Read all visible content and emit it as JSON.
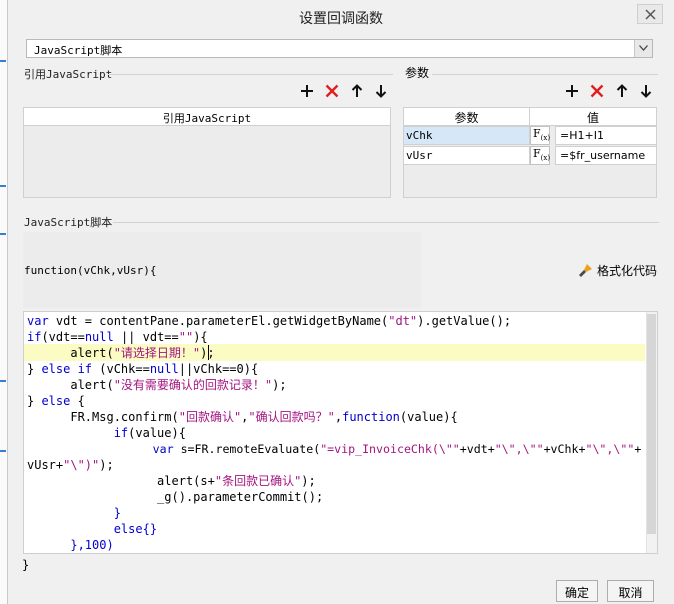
{
  "dialog": {
    "title": "设置回调函数"
  },
  "dropdown": {
    "selected": "JavaScript脚本"
  },
  "ref_section": {
    "label": "引用JavaScript",
    "column_header": "引用JavaScript"
  },
  "param_section": {
    "label": "参数",
    "columns": [
      "参数",
      "值"
    ],
    "rows": [
      {
        "name": "vChk",
        "fx": "F",
        "fx_sub": "(x)",
        "value": "=H1+I1"
      },
      {
        "name": "vUsr",
        "fx": "F",
        "fx_sub": "(x)",
        "value": "=$fr_username"
      }
    ]
  },
  "script_section": {
    "label": "JavaScript脚本",
    "signature": "function(vChk,vUsr){",
    "format_button": "格式化代码",
    "closing_brace": "}"
  },
  "code": {
    "l1": [
      "var",
      " vdt = contentPane.parameterEl.getWidgetByName(",
      "\"dt\"",
      ").getValue();"
    ],
    "l2": [
      "if",
      "(vdt==",
      "null",
      " || vdt==",
      "\"\"",
      "){"
    ],
    "l3": [
      "      alert(",
      "\"请选择日期！\"",
      ");"
    ],
    "l4": [
      "} ",
      "else if",
      " (vChk==",
      "null",
      "||vChk==0){"
    ],
    "l5": [
      "      alert(",
      "\"没有需要确认的回款记录！\"",
      ");"
    ],
    "l6": [
      "} ",
      "else",
      " {"
    ],
    "l7": [
      "      FR.Msg.confirm(",
      "\"回款确认\"",
      ",",
      "\"确认回款吗？\"",
      ",",
      "function",
      "(value){"
    ],
    "l8": [
      "            ",
      "if",
      "(value){"
    ],
    "l9": [
      "                  ",
      "var",
      " s=FR.remoteEvaluate(",
      "\"=vip_InvoiceChk(\\\"\"",
      "+vdt+",
      "\"\\\",\\\"\"",
      "+vChk+",
      "\"\\\",\\\"\"",
      "+"
    ],
    "l10": [
      "vUsr+",
      "\"\\\")\"",
      ");"
    ],
    "l11": [
      "                  alert(s+",
      "\"条回款已确认\"",
      ");"
    ],
    "l12": [
      "                  _g().parameterCommit();"
    ],
    "l13": [
      "            }"
    ],
    "l14": [
      "            ",
      "else",
      "{}"
    ],
    "l15": [
      "      },100)"
    ]
  },
  "buttons": {
    "ok": "确定",
    "cancel": "取消"
  },
  "colors": {
    "keyword": "#0000cc",
    "string": "#a31580",
    "delete": "#e02020",
    "highlight": "#fbfbc4"
  },
  "icons": [
    "close-icon",
    "chevron-down-icon",
    "add-icon",
    "delete-icon",
    "arrow-up-icon",
    "arrow-down-icon",
    "brush-icon"
  ]
}
